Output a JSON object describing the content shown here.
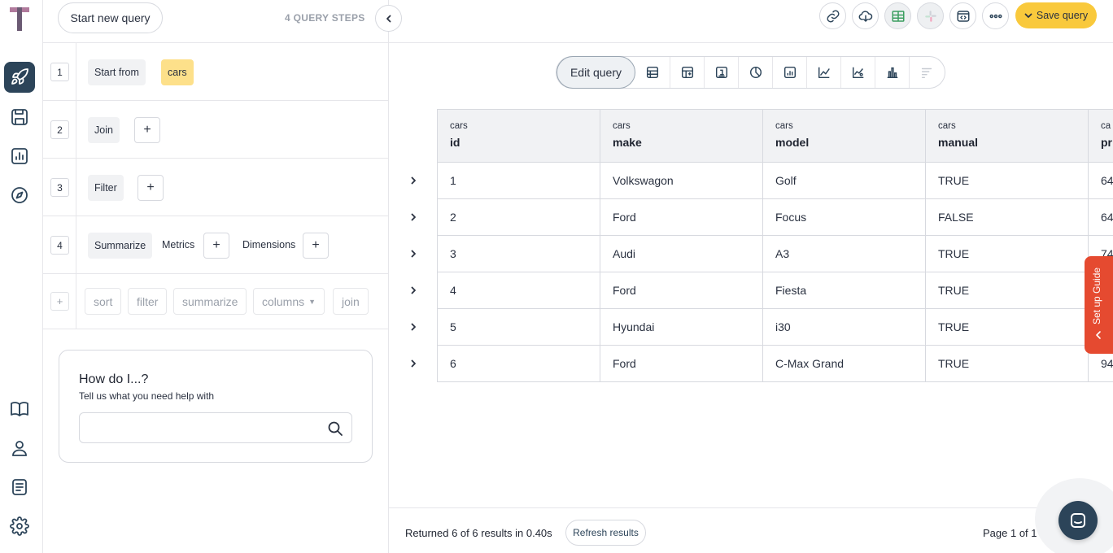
{
  "app": {
    "logo_letter": "T"
  },
  "rail": {
    "items": [
      "rocket-icon",
      "save-icon",
      "dashboard-icon",
      "compass-icon",
      "book-icon",
      "user-icon",
      "notes-icon",
      "gear-icon"
    ],
    "active": "rocket-icon",
    "active_color": "#2c4459"
  },
  "query_panel": {
    "start_new_label": "Start new query",
    "steps_count_label": "4 QUERY STEPS",
    "steps": [
      {
        "number": "1",
        "label": "Start from",
        "value": "cars"
      },
      {
        "number": "2",
        "label": "Join"
      },
      {
        "number": "3",
        "label": "Filter"
      },
      {
        "number": "4",
        "label": "Summarize",
        "metrics_label": "Metrics",
        "dimensions_label": "Dimensions"
      }
    ],
    "add_step": {
      "plus": "+",
      "options": [
        "sort",
        "filter",
        "summarize",
        "columns",
        "join"
      ]
    },
    "plus": "+"
  },
  "help": {
    "title": "How do I...?",
    "subtitle": "Tell us what you need help with",
    "search_placeholder": ""
  },
  "toolbar": {
    "icons": [
      "link-icon",
      "cloud-download-icon",
      "table-view-icon",
      "slack-icon",
      "embed-icon",
      "more-icon"
    ],
    "save_label": "Save query",
    "save_color": "#f9c93c"
  },
  "viz_bar": {
    "edit_label": "Edit query",
    "icons": [
      "table-icon",
      "pivot-icon",
      "number-icon",
      "pie-icon",
      "combo-icon",
      "line-icon",
      "scatter-icon",
      "bar-icon",
      "list-icon"
    ]
  },
  "table": {
    "columns": [
      {
        "table": "cars",
        "name": "id"
      },
      {
        "table": "cars",
        "name": "make"
      },
      {
        "table": "cars",
        "name": "model"
      },
      {
        "table": "cars",
        "name": "manual"
      },
      {
        "table": "ca",
        "name": "pr"
      }
    ],
    "rows": [
      [
        "1",
        "Volkswagon",
        "Golf",
        "TRUE",
        "64"
      ],
      [
        "2",
        "Ford",
        "Focus",
        "FALSE",
        "64"
      ],
      [
        "3",
        "Audi",
        "A3",
        "TRUE",
        "74"
      ],
      [
        "4",
        "Ford",
        "Fiesta",
        "TRUE",
        ""
      ],
      [
        "5",
        "Hyundai",
        "i30",
        "TRUE",
        ""
      ],
      [
        "6",
        "Ford",
        "C-Max Grand",
        "TRUE",
        "94"
      ]
    ]
  },
  "guide": {
    "label": "Set up Guide",
    "color": "#e54a30"
  },
  "footer": {
    "returned": "Returned 6 of 6 results in 0.40s",
    "refresh_label": "Refresh results",
    "page_label": "Page 1 of 1"
  }
}
